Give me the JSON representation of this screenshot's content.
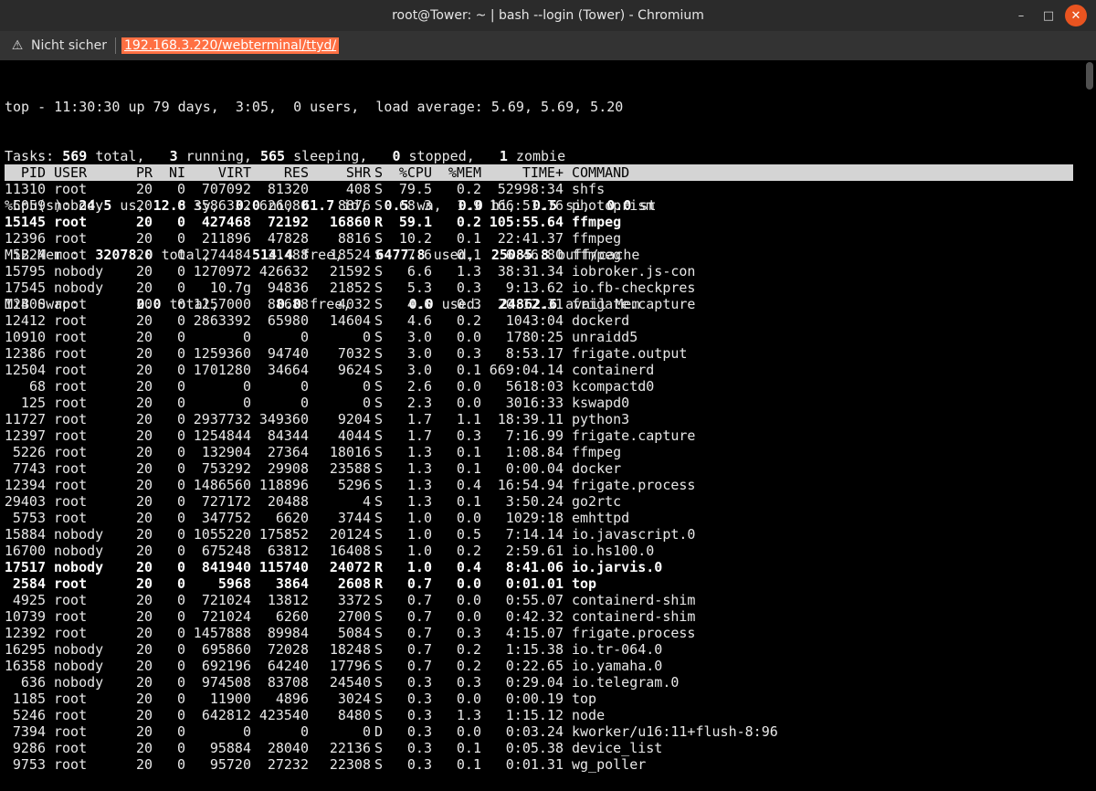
{
  "window": {
    "title": "root@Tower: ~ | bash --login (Tower) - Chromium"
  },
  "addressbar": {
    "security_label": "Nicht sicher",
    "url": "192.168.3.220/webterminal/ttyd/"
  },
  "summary": {
    "line1": "top - 11:30:30 up 79 days,  3:05,  0 users,  load average: 5.69, 5.69, 5.20",
    "tasks": {
      "total": "569",
      "running": "3",
      "sleeping": "565",
      "stopped": "0",
      "zombie": "1"
    },
    "cpu": {
      "us": "24.5",
      "sy": "12.8",
      "ni": "0.0",
      "id": "61.7",
      "wa": "0.5",
      "hi": "0.0",
      "si": "0.5",
      "st": "0.0"
    },
    "mem": {
      "total": "32078.0",
      "free": "514.4",
      "used": "6477.8",
      "buff_cache": "25085.8"
    },
    "swap": {
      "total": "0.0",
      "free": "0.0",
      "used": "0.0",
      "avail_mem": "24862.6"
    }
  },
  "header": [
    "PID",
    "USER",
    "PR",
    "NI",
    "VIRT",
    "RES",
    "SHR",
    "S",
    "%CPU",
    "%MEM",
    "TIME+",
    "COMMAND"
  ],
  "processes": [
    {
      "pid": "11310",
      "user": "root",
      "pr": "20",
      "ni": "0",
      "virt": "707092",
      "res": "81320",
      "shr": "408",
      "s": "S",
      "cpu": "79.5",
      "mem": "0.2",
      "time": "52998:34",
      "cmd": "shfs",
      "bold": false
    },
    {
      "pid": "5059",
      "user": "nobody",
      "pr": "20",
      "ni": "0",
      "virt": "3586332",
      "res": "626080",
      "shr": "8876",
      "s": "S",
      "cpu": "68.3",
      "mem": "1.9",
      "time": "166:51.76",
      "cmd": "photoprism",
      "bold": false
    },
    {
      "pid": "15145",
      "user": "root",
      "pr": "20",
      "ni": "0",
      "virt": "427468",
      "res": "72192",
      "shr": "16860",
      "s": "R",
      "cpu": "59.1",
      "mem": "0.2",
      "time": "105:55.64",
      "cmd": "ffmpeg",
      "bold": true
    },
    {
      "pid": "12396",
      "user": "root",
      "pr": "20",
      "ni": "0",
      "virt": "211896",
      "res": "47828",
      "shr": "8816",
      "s": "S",
      "cpu": "10.2",
      "mem": "0.1",
      "time": "22:41.37",
      "cmd": "ffmpeg",
      "bold": false
    },
    {
      "pid": "5224",
      "user": "root",
      "pr": "20",
      "ni": "0",
      "virt": "274484",
      "res": "31488",
      "shr": "18524",
      "s": "S",
      "cpu": "7.6",
      "mem": "0.1",
      "time": "6:46.80",
      "cmd": "ffmpeg",
      "bold": false
    },
    {
      "pid": "15795",
      "user": "nobody",
      "pr": "20",
      "ni": "0",
      "virt": "1270972",
      "res": "426632",
      "shr": "21592",
      "s": "S",
      "cpu": "6.6",
      "mem": "1.3",
      "time": "38:31.34",
      "cmd": "iobroker.js-con",
      "bold": false
    },
    {
      "pid": "17545",
      "user": "nobody",
      "pr": "20",
      "ni": "0",
      "virt": "10.7g",
      "res": "94836",
      "shr": "21852",
      "s": "S",
      "cpu": "5.3",
      "mem": "0.3",
      "time": "9:13.62",
      "cmd": "io.fb-checkpres",
      "bold": false
    },
    {
      "pid": "12400",
      "user": "root",
      "pr": "20",
      "ni": "0",
      "virt": "1257000",
      "res": "88688",
      "shr": "4032",
      "s": "S",
      "cpu": "4.6",
      "mem": "0.3",
      "time": "20:12.31",
      "cmd": "frigate.capture",
      "bold": false
    },
    {
      "pid": "12412",
      "user": "root",
      "pr": "20",
      "ni": "0",
      "virt": "2863392",
      "res": "65980",
      "shr": "14604",
      "s": "S",
      "cpu": "4.6",
      "mem": "0.2",
      "time": "1043:04",
      "cmd": "dockerd",
      "bold": false
    },
    {
      "pid": "10910",
      "user": "root",
      "pr": "20",
      "ni": "0",
      "virt": "0",
      "res": "0",
      "shr": "0",
      "s": "S",
      "cpu": "3.0",
      "mem": "0.0",
      "time": "1780:25",
      "cmd": "unraidd5",
      "bold": false
    },
    {
      "pid": "12386",
      "user": "root",
      "pr": "20",
      "ni": "0",
      "virt": "1259360",
      "res": "94740",
      "shr": "7032",
      "s": "S",
      "cpu": "3.0",
      "mem": "0.3",
      "time": "8:53.17",
      "cmd": "frigate.output",
      "bold": false
    },
    {
      "pid": "12504",
      "user": "root",
      "pr": "20",
      "ni": "0",
      "virt": "1701280",
      "res": "34664",
      "shr": "9624",
      "s": "S",
      "cpu": "3.0",
      "mem": "0.1",
      "time": "669:04.14",
      "cmd": "containerd",
      "bold": false
    },
    {
      "pid": "68",
      "user": "root",
      "pr": "20",
      "ni": "0",
      "virt": "0",
      "res": "0",
      "shr": "0",
      "s": "S",
      "cpu": "2.6",
      "mem": "0.0",
      "time": "5618:03",
      "cmd": "kcompactd0",
      "bold": false
    },
    {
      "pid": "125",
      "user": "root",
      "pr": "20",
      "ni": "0",
      "virt": "0",
      "res": "0",
      "shr": "0",
      "s": "S",
      "cpu": "2.3",
      "mem": "0.0",
      "time": "3016:33",
      "cmd": "kswapd0",
      "bold": false
    },
    {
      "pid": "11727",
      "user": "root",
      "pr": "20",
      "ni": "0",
      "virt": "2937732",
      "res": "349360",
      "shr": "9204",
      "s": "S",
      "cpu": "1.7",
      "mem": "1.1",
      "time": "18:39.11",
      "cmd": "python3",
      "bold": false
    },
    {
      "pid": "12397",
      "user": "root",
      "pr": "20",
      "ni": "0",
      "virt": "1254844",
      "res": "84344",
      "shr": "4044",
      "s": "S",
      "cpu": "1.7",
      "mem": "0.3",
      "time": "7:16.99",
      "cmd": "frigate.capture",
      "bold": false
    },
    {
      "pid": "5226",
      "user": "root",
      "pr": "20",
      "ni": "0",
      "virt": "132904",
      "res": "27364",
      "shr": "18016",
      "s": "S",
      "cpu": "1.3",
      "mem": "0.1",
      "time": "1:08.84",
      "cmd": "ffmpeg",
      "bold": false
    },
    {
      "pid": "7743",
      "user": "root",
      "pr": "20",
      "ni": "0",
      "virt": "753292",
      "res": "29908",
      "shr": "23588",
      "s": "S",
      "cpu": "1.3",
      "mem": "0.1",
      "time": "0:00.04",
      "cmd": "docker",
      "bold": false
    },
    {
      "pid": "12394",
      "user": "root",
      "pr": "20",
      "ni": "0",
      "virt": "1486560",
      "res": "118896",
      "shr": "5296",
      "s": "S",
      "cpu": "1.3",
      "mem": "0.4",
      "time": "16:54.94",
      "cmd": "frigate.process",
      "bold": false
    },
    {
      "pid": "29403",
      "user": "root",
      "pr": "20",
      "ni": "0",
      "virt": "727172",
      "res": "20488",
      "shr": "4",
      "s": "S",
      "cpu": "1.3",
      "mem": "0.1",
      "time": "3:50.24",
      "cmd": "go2rtc",
      "bold": false
    },
    {
      "pid": "5753",
      "user": "root",
      "pr": "20",
      "ni": "0",
      "virt": "347752",
      "res": "6620",
      "shr": "3744",
      "s": "S",
      "cpu": "1.0",
      "mem": "0.0",
      "time": "1029:18",
      "cmd": "emhttpd",
      "bold": false
    },
    {
      "pid": "15884",
      "user": "nobody",
      "pr": "20",
      "ni": "0",
      "virt": "1055220",
      "res": "175852",
      "shr": "20124",
      "s": "S",
      "cpu": "1.0",
      "mem": "0.5",
      "time": "7:14.14",
      "cmd": "io.javascript.0",
      "bold": false
    },
    {
      "pid": "16700",
      "user": "nobody",
      "pr": "20",
      "ni": "0",
      "virt": "675248",
      "res": "63812",
      "shr": "16408",
      "s": "S",
      "cpu": "1.0",
      "mem": "0.2",
      "time": "2:59.61",
      "cmd": "io.hs100.0",
      "bold": false
    },
    {
      "pid": "17517",
      "user": "nobody",
      "pr": "20",
      "ni": "0",
      "virt": "841940",
      "res": "115740",
      "shr": "24072",
      "s": "R",
      "cpu": "1.0",
      "mem": "0.4",
      "time": "8:41.06",
      "cmd": "io.jarvis.0",
      "bold": true
    },
    {
      "pid": "2584",
      "user": "root",
      "pr": "20",
      "ni": "0",
      "virt": "5968",
      "res": "3864",
      "shr": "2608",
      "s": "R",
      "cpu": "0.7",
      "mem": "0.0",
      "time": "0:01.01",
      "cmd": "top",
      "bold": true
    },
    {
      "pid": "4925",
      "user": "root",
      "pr": "20",
      "ni": "0",
      "virt": "721024",
      "res": "13812",
      "shr": "3372",
      "s": "S",
      "cpu": "0.7",
      "mem": "0.0",
      "time": "0:55.07",
      "cmd": "containerd-shim",
      "bold": false
    },
    {
      "pid": "10739",
      "user": "root",
      "pr": "20",
      "ni": "0",
      "virt": "721024",
      "res": "6260",
      "shr": "2700",
      "s": "S",
      "cpu": "0.7",
      "mem": "0.0",
      "time": "0:42.32",
      "cmd": "containerd-shim",
      "bold": false
    },
    {
      "pid": "12392",
      "user": "root",
      "pr": "20",
      "ni": "0",
      "virt": "1457888",
      "res": "89984",
      "shr": "5084",
      "s": "S",
      "cpu": "0.7",
      "mem": "0.3",
      "time": "4:15.07",
      "cmd": "frigate.process",
      "bold": false
    },
    {
      "pid": "16295",
      "user": "nobody",
      "pr": "20",
      "ni": "0",
      "virt": "695860",
      "res": "72028",
      "shr": "18248",
      "s": "S",
      "cpu": "0.7",
      "mem": "0.2",
      "time": "1:15.38",
      "cmd": "io.tr-064.0",
      "bold": false
    },
    {
      "pid": "16358",
      "user": "nobody",
      "pr": "20",
      "ni": "0",
      "virt": "692196",
      "res": "64240",
      "shr": "17796",
      "s": "S",
      "cpu": "0.7",
      "mem": "0.2",
      "time": "0:22.65",
      "cmd": "io.yamaha.0",
      "bold": false
    },
    {
      "pid": "636",
      "user": "nobody",
      "pr": "20",
      "ni": "0",
      "virt": "974508",
      "res": "83708",
      "shr": "24540",
      "s": "S",
      "cpu": "0.3",
      "mem": "0.3",
      "time": "0:29.04",
      "cmd": "io.telegram.0",
      "bold": false
    },
    {
      "pid": "1185",
      "user": "root",
      "pr": "20",
      "ni": "0",
      "virt": "11900",
      "res": "4896",
      "shr": "3024",
      "s": "S",
      "cpu": "0.3",
      "mem": "0.0",
      "time": "0:00.19",
      "cmd": "top",
      "bold": false
    },
    {
      "pid": "5246",
      "user": "root",
      "pr": "20",
      "ni": "0",
      "virt": "642812",
      "res": "423540",
      "shr": "8480",
      "s": "S",
      "cpu": "0.3",
      "mem": "1.3",
      "time": "1:15.12",
      "cmd": "node",
      "bold": false
    },
    {
      "pid": "7394",
      "user": "root",
      "pr": "20",
      "ni": "0",
      "virt": "0",
      "res": "0",
      "shr": "0",
      "s": "D",
      "cpu": "0.3",
      "mem": "0.0",
      "time": "0:03.24",
      "cmd": "kworker/u16:11+flush-8:96",
      "bold": false
    },
    {
      "pid": "9286",
      "user": "root",
      "pr": "20",
      "ni": "0",
      "virt": "95884",
      "res": "28040",
      "shr": "22136",
      "s": "S",
      "cpu": "0.3",
      "mem": "0.1",
      "time": "0:05.38",
      "cmd": "device_list",
      "bold": false
    },
    {
      "pid": "9753",
      "user": "root",
      "pr": "20",
      "ni": "0",
      "virt": "95720",
      "res": "27232",
      "shr": "22308",
      "s": "S",
      "cpu": "0.3",
      "mem": "0.1",
      "time": "0:01.31",
      "cmd": "wg_poller",
      "bold": false
    }
  ],
  "icons": {
    "warning": "warning-triangle-icon",
    "minimize": "minimize-icon",
    "maximize": "maximize-icon",
    "close": "close-icon"
  },
  "colors": {
    "url_highlight": "#ff7043",
    "close_button": "#e95420",
    "header_bg": "#d4d4d4"
  }
}
